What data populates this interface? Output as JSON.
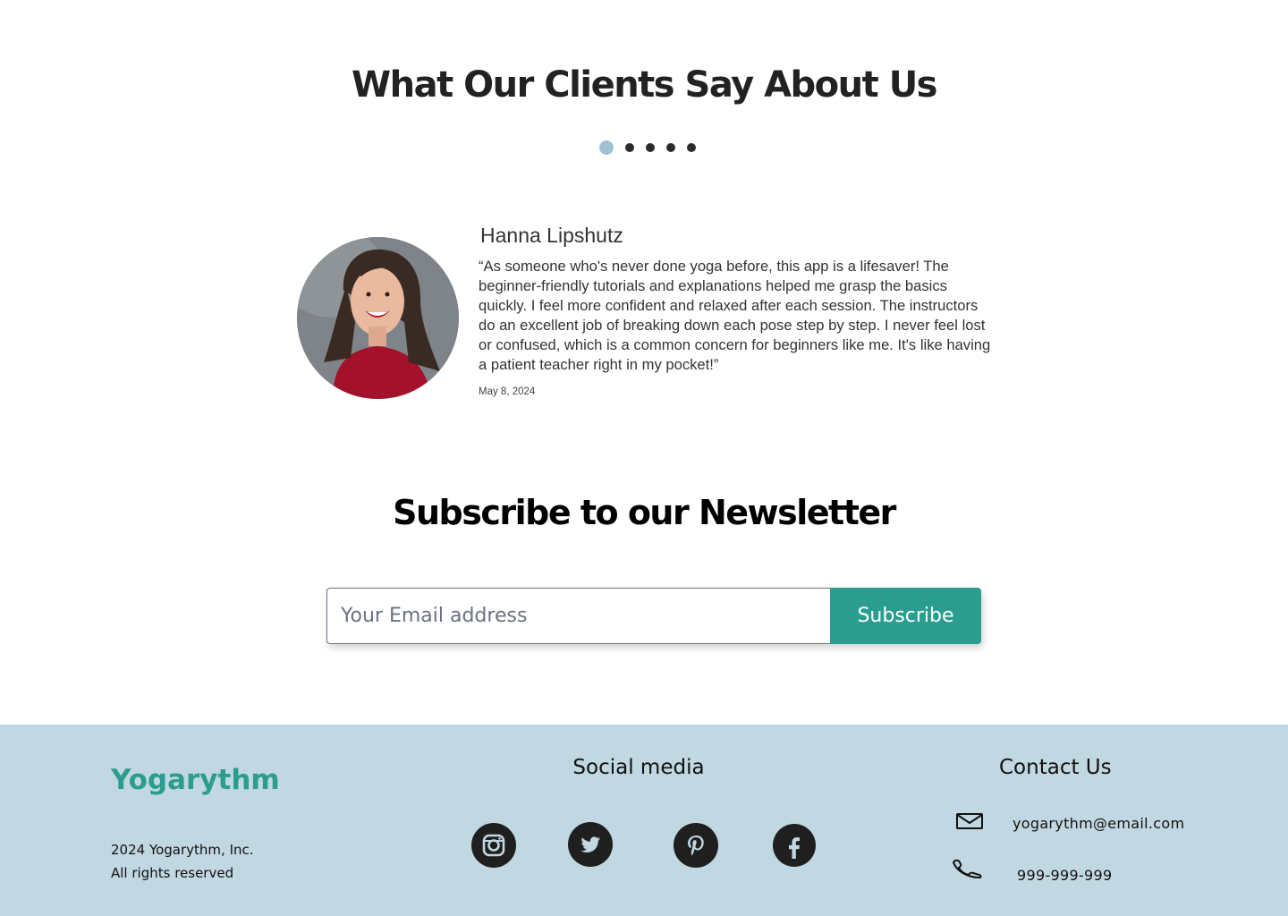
{
  "testimonials": {
    "title": "What Our Clients Say About Us",
    "active_slide": 1,
    "slide_count": 5,
    "review": {
      "name": "Hanna Lipshutz",
      "quote": "“As someone who's never done yoga before, this app is a lifesaver! The beginner-friendly tutorials and explanations helped me grasp the basics quickly. I feel more confident and relaxed after each session. The instructors do an excellent job of breaking down each pose step by step. I never feel lost or confused, which is a common concern for beginners like me. It's like having a patient teacher right in my pocket!”",
      "date": "May 8, 2024"
    }
  },
  "newsletter": {
    "title": "Subscribe to our Newsletter",
    "email_placeholder": "Your Email address",
    "email_value": "",
    "subscribe_label": "Subscribe"
  },
  "footer": {
    "brand": "Yogarythm",
    "copyright_line1": "2024 Yogarythm, Inc.",
    "copyright_line2": "All rights reserved",
    "social_title": "Social media",
    "social_icons": [
      "instagram-icon",
      "twitter-icon",
      "pinterest-icon",
      "facebook-icon"
    ],
    "contact_title": "Contact Us",
    "email": "yogarythm@email.com",
    "phone": "999-999-999"
  },
  "colors": {
    "accent": "#2a9d8f",
    "footer_bg": "#c1d7e1",
    "active_dot": "#9fc1d4"
  }
}
